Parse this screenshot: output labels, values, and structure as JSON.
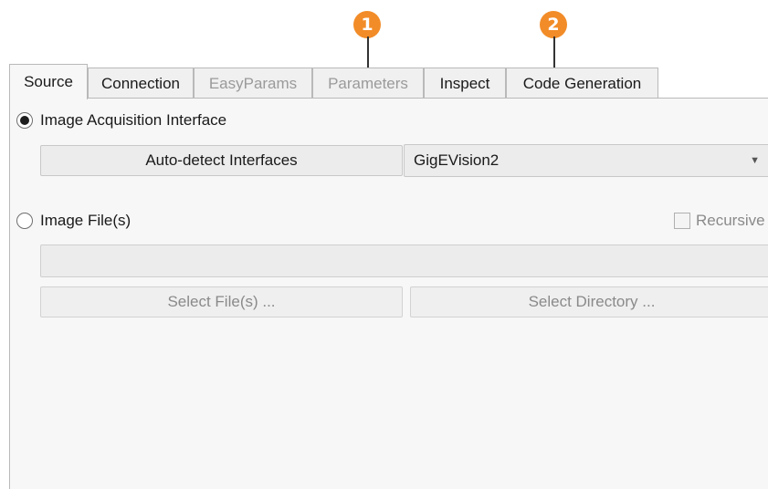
{
  "callouts": [
    "1",
    "2"
  ],
  "tabs": [
    {
      "label": "Source",
      "state": "active"
    },
    {
      "label": "Connection",
      "state": "normal"
    },
    {
      "label": "EasyParams",
      "state": "disabled"
    },
    {
      "label": "Parameters",
      "state": "disabled"
    },
    {
      "label": "Inspect",
      "state": "normal"
    },
    {
      "label": "Code Generation",
      "state": "normal"
    }
  ],
  "source": {
    "acquisition_radio_label": "Image Acquisition Interface",
    "acquisition_selected": true,
    "autodetect_button_label": "Auto-detect Interfaces",
    "interface_select_value": "GigEVision2",
    "image_files_radio_label": "Image File(s)",
    "image_files_selected": false,
    "recursive_label": "Recursive",
    "recursive_checked": false,
    "file_path_value": "",
    "select_files_label": "Select File(s) ...",
    "select_directory_label": "Select Directory ..."
  },
  "colors": {
    "callout": "#f28c28",
    "panel": "#f7f7f7",
    "border": "#b9b9b9"
  }
}
